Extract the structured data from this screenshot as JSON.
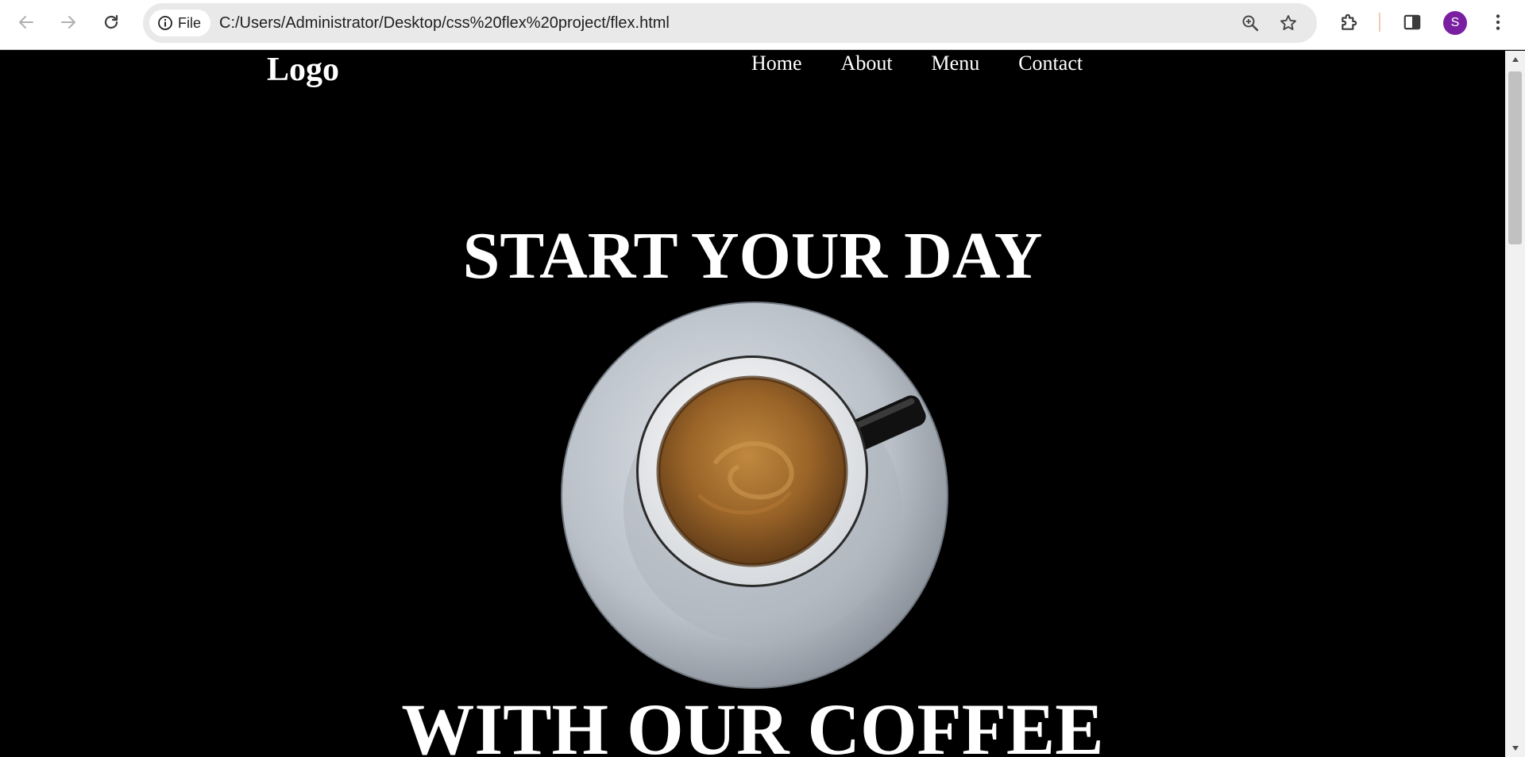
{
  "browser": {
    "back_icon": "arrow-left-icon",
    "forward_icon": "arrow-right-icon",
    "reload_icon": "reload-icon",
    "site_info_label": "File",
    "url": "C:/Users/Administrator/Desktop/css%20flex%20project/flex.html",
    "zoom_icon": "zoom-icon",
    "bookmark_icon": "star-icon",
    "extensions_icon": "puzzle-icon",
    "side_panel_icon": "side-panel-icon",
    "profile_initial": "S",
    "profile_color": "#7b1fa2",
    "menu_icon": "kebab-menu-icon"
  },
  "page": {
    "background": "#000000",
    "text_color": "#ffffff",
    "logo": "Logo",
    "nav": [
      "Home",
      "About",
      "Menu",
      "Contact"
    ],
    "hero": {
      "title_top": "START YOUR DAY",
      "title_bottom": "WITH OUR COFFEE",
      "image": "coffee-cup-on-saucer"
    }
  }
}
